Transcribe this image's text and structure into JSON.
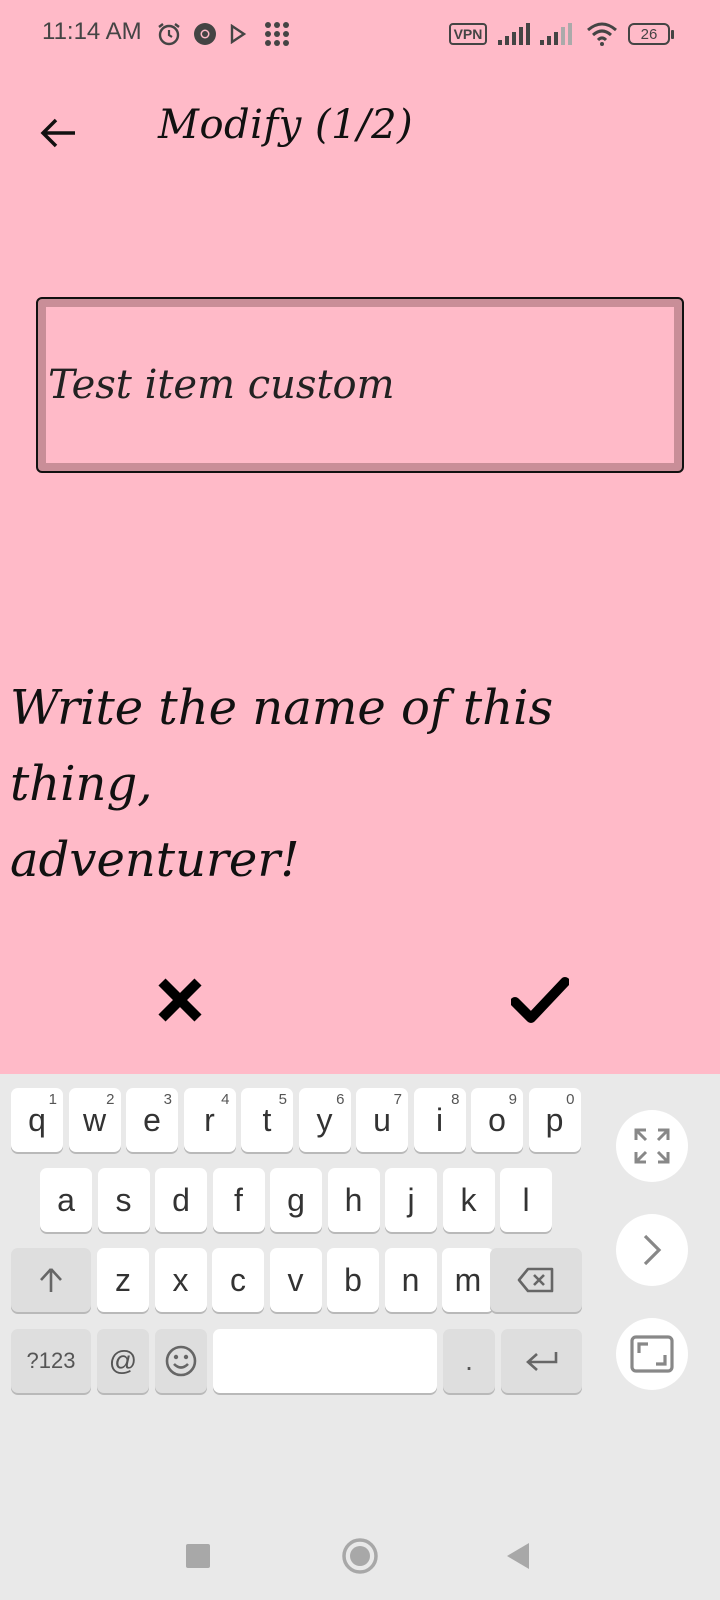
{
  "status_bar": {
    "time": "11:14 AM",
    "vpn_label": "VPN",
    "battery": "26",
    "icons": [
      "alarm-icon",
      "chrome-icon",
      "play-icon",
      "apps-grid-icon",
      "vpn-icon",
      "signal-icon",
      "signal-icon",
      "wifi-icon",
      "battery-icon"
    ]
  },
  "header": {
    "title": "Modify (1/2)",
    "back_icon": "arrow-left-icon"
  },
  "name_field": {
    "value": "Test item custom"
  },
  "prompt": {
    "line1": "Write the name of this thing,",
    "line2": "adventurer!"
  },
  "actions": {
    "cancel_icon": "close-icon",
    "confirm_icon": "check-icon"
  },
  "keyboard": {
    "row1": [
      {
        "key": "q",
        "hint": "1"
      },
      {
        "key": "w",
        "hint": "2"
      },
      {
        "key": "e",
        "hint": "3"
      },
      {
        "key": "r",
        "hint": "4"
      },
      {
        "key": "t",
        "hint": "5"
      },
      {
        "key": "y",
        "hint": "6"
      },
      {
        "key": "u",
        "hint": "7"
      },
      {
        "key": "i",
        "hint": "8"
      },
      {
        "key": "o",
        "hint": "9"
      },
      {
        "key": "p",
        "hint": "0"
      }
    ],
    "row2": [
      "a",
      "s",
      "d",
      "f",
      "g",
      "h",
      "j",
      "k",
      "l"
    ],
    "row3": [
      "z",
      "x",
      "c",
      "v",
      "b",
      "n",
      "m"
    ],
    "symbols_label": "?123",
    "at_label": "@",
    "period_label": ".",
    "shift_icon": "shift-arrow-icon",
    "backspace_icon": "backspace-icon",
    "emoji_icon": "emoji-icon",
    "enter_icon": "enter-icon",
    "side_icons": [
      "expand-icon",
      "chevron-right-icon",
      "resize-icon"
    ]
  },
  "nav": {
    "icons": [
      "recents-square-icon",
      "home-circle-icon",
      "back-triangle-icon"
    ]
  },
  "colors": {
    "background": "#ffbac8",
    "field_border": "#c98e98",
    "keyboard_bg": "#e9e9e9"
  }
}
